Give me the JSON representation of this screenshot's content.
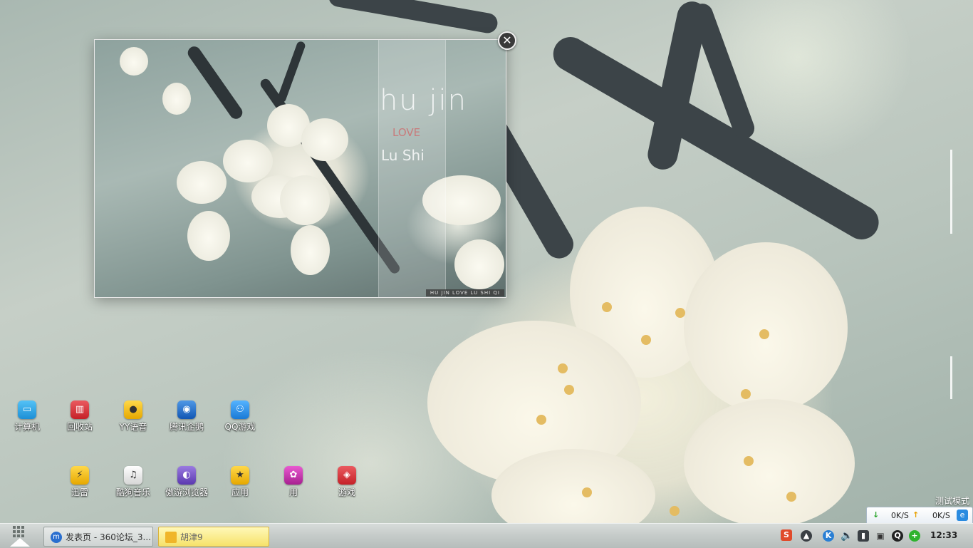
{
  "photo_window": {
    "title_line1": "hu jin",
    "title_line2": "LOVE",
    "title_line3": "Lu Shi",
    "footer": "HU JIN  LOVE  LU SHI QI",
    "close_label": "✕"
  },
  "desktop_icons_row1": [
    {
      "label": "计算机",
      "icon": "computer-icon",
      "color": "#2aa6e8"
    },
    {
      "label": "回收站",
      "icon": "recycle-bin-icon",
      "color": "#d9333a"
    },
    {
      "label": "YY语音",
      "icon": "yy-voice-icon",
      "color": "#f3b911"
    },
    {
      "label": "腾讯企鹅",
      "icon": "tencent-penguin-icon",
      "color": "#1f73d0"
    },
    {
      "label": "QQ游戏",
      "icon": "qq-game-icon",
      "color": "#2792e8"
    }
  ],
  "desktop_icons_row2": [
    {
      "label": "迅雷",
      "icon": "thunder-icon",
      "color": "#f3b911"
    },
    {
      "label": "酷狗音乐",
      "icon": "kugou-music-icon",
      "color": "#e9e9e9"
    },
    {
      "label": "傲游浏览器",
      "icon": "maxthon-browser-icon",
      "color": "#7a57c9"
    },
    {
      "label": "应用",
      "icon": "apps-icon",
      "color": "#f3b911"
    },
    {
      "label": "用",
      "icon": "app-icon",
      "color": "#d43bb8"
    },
    {
      "label": "游戏",
      "icon": "game-icon",
      "color": "#d9333a"
    }
  ],
  "taskbar": {
    "tasks": [
      {
        "label": "发表页 - 360论坛_3...",
        "icon": "maxthon-icon"
      },
      {
        "label": "胡津9",
        "icon": "folder-icon"
      }
    ],
    "clock": "12:33"
  },
  "net_speed": {
    "download": "0K/S",
    "upload": "0K/S"
  },
  "test_mode_label": "测试模式",
  "colors": {
    "taskbar_bg": "#c5cbc9",
    "active_task": "#f6e26a",
    "accent": "#2aa6e8"
  }
}
